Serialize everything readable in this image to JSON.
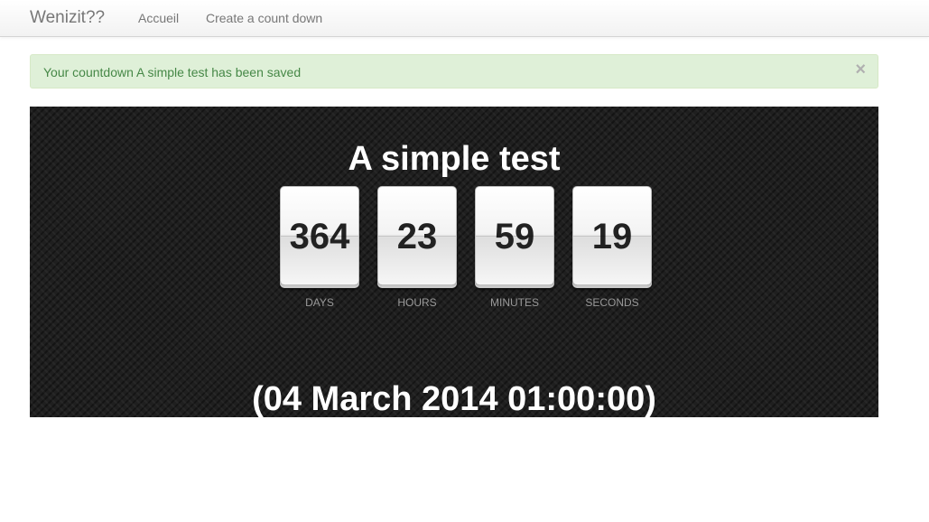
{
  "navbar": {
    "brand": "Wenizit??",
    "links": [
      {
        "label": "Accueil"
      },
      {
        "label": "Create a count down"
      }
    ]
  },
  "alert": {
    "message": "Your countdown A simple test has been saved",
    "close_symbol": "×"
  },
  "countdown": {
    "title": "A simple test",
    "units": [
      {
        "value": "364",
        "label": "DAYS"
      },
      {
        "value": "23",
        "label": "HOURS"
      },
      {
        "value": "59",
        "label": "MINUTES"
      },
      {
        "value": "19",
        "label": "SECONDS"
      }
    ],
    "date_text": "(04 March 2014 01:00:00)"
  },
  "colors": {
    "alert_bg": "#dff0d8",
    "alert_text": "#468847",
    "panel_bg": "#1f1f1f"
  }
}
